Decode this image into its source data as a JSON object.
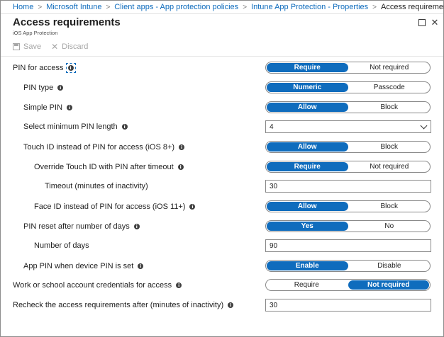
{
  "breadcrumb": {
    "items": [
      "Home",
      "Microsoft Intune",
      "Client apps - App protection policies",
      "Intune App Protection - Properties"
    ],
    "current": "Access requirements",
    "separator": ">"
  },
  "blade": {
    "title": "Access requirements",
    "subtitle": "iOS App Protection"
  },
  "toolbar": {
    "save_label": "Save",
    "discard_label": "Discard"
  },
  "info_glyph": "i",
  "rows": [
    {
      "label": "PIN for access",
      "options": [
        "Require",
        "Not required"
      ],
      "selected": 0
    },
    {
      "label": "PIN type",
      "options": [
        "Numeric",
        "Passcode"
      ],
      "selected": 0
    },
    {
      "label": "Simple PIN",
      "options": [
        "Allow",
        "Block"
      ],
      "selected": 0
    },
    {
      "label": "Select minimum PIN length",
      "value": "4"
    },
    {
      "label": "Touch ID instead of PIN for access (iOS 8+)",
      "options": [
        "Allow",
        "Block"
      ],
      "selected": 0
    },
    {
      "label": "Override Touch ID with PIN after timeout",
      "options": [
        "Require",
        "Not required"
      ],
      "selected": 0
    },
    {
      "label": "Timeout (minutes of inactivity)",
      "value": "30"
    },
    {
      "label": "Face ID instead of PIN for access (iOS 11+)",
      "options": [
        "Allow",
        "Block"
      ],
      "selected": 0
    },
    {
      "label": "PIN reset after number of days",
      "options": [
        "Yes",
        "No"
      ],
      "selected": 0
    },
    {
      "label": "Number of days",
      "value": "90"
    },
    {
      "label": "App PIN when device PIN is set",
      "options": [
        "Enable",
        "Disable"
      ],
      "selected": 0
    },
    {
      "label": "Work or school account credentials for access",
      "options": [
        "Require",
        "Not required"
      ],
      "selected": 1
    },
    {
      "label": "Recheck the access requirements after (minutes of inactivity)",
      "value": "30"
    }
  ],
  "colors": {
    "accent": "#0f6cbd",
    "toggle_border": "#8a8a8a",
    "disabled_text": "#a6a6a6"
  }
}
